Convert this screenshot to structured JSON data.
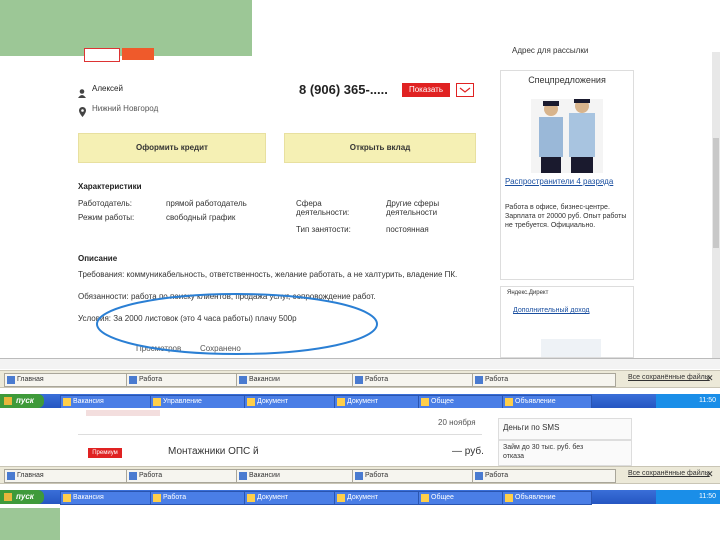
{
  "seller": {
    "name": "Алексей",
    "city": "Нижний Новгород",
    "phone": "8 (906) 365-.....",
    "show_button": "Показать"
  },
  "actions": {
    "credit_label": "Оформить кредит",
    "deposit_label": "Открыть вклад"
  },
  "characteristics": {
    "heading": "Характеристики",
    "left": [
      {
        "label": "Работодатель:",
        "value": "прямой работодатель"
      },
      {
        "label": "Режим работы:",
        "value": "свободный график"
      }
    ],
    "right": [
      {
        "label": "Сфера деятельности:",
        "value": "Другие сферы деятельности"
      },
      {
        "label": "Тип занятости:",
        "value": "постоянная"
      }
    ]
  },
  "description": {
    "heading": "Описание",
    "line1": "Требования: коммуникабельность, ответственность, желание работать, а не халтурить, владение ПК.",
    "line2": "Обязанности: работа по поиску клиентов, продажа услуг, сопровождение работ.",
    "line3": "Условия: За 2000 листовок (это 4 часа работы) плачу 500р",
    "meta": [
      "Просмотров",
      "Сохранено"
    ]
  },
  "sidebar": {
    "top_link": "Адрес для рассылки",
    "special_title": "Спецпредложения",
    "ad_title": "Распространители 4 разряда",
    "ad_text": "Работа в офисе, бизнес-центре. Зарплата от 20000 руб. Опыт работы не требуется. Официально.",
    "yandex_label": "Яндекс.Директ",
    "yandex_link": "Дополнительный доход",
    "promo_sms": "Деньги по SMS",
    "promo_line": "Займ до 30 тыс. руб. без отказа"
  },
  "windows_bar": {
    "tabs": [
      "Главная",
      "Работа",
      "Вакансии",
      "Работа",
      "Работа"
    ],
    "right": "Все сохранённые файлы"
  },
  "taskbar_top": {
    "start": "пуск",
    "tasks": [
      "Вакансия",
      "Управление",
      "Документ",
      "Документ",
      "Общее",
      "Объявление"
    ],
    "clock": "11:50"
  },
  "lower_page": {
    "date": "20 ноября",
    "vacancy": "Монтажники ОПС й",
    "price": "— руб.",
    "badge": "Премиум"
  },
  "taskbar_bottom": {
    "start": "пуск",
    "tasks": [
      "Вакансия",
      "Работа",
      "Документ",
      "Документ",
      "Общее",
      "Объявление"
    ],
    "clock": "11:50"
  }
}
